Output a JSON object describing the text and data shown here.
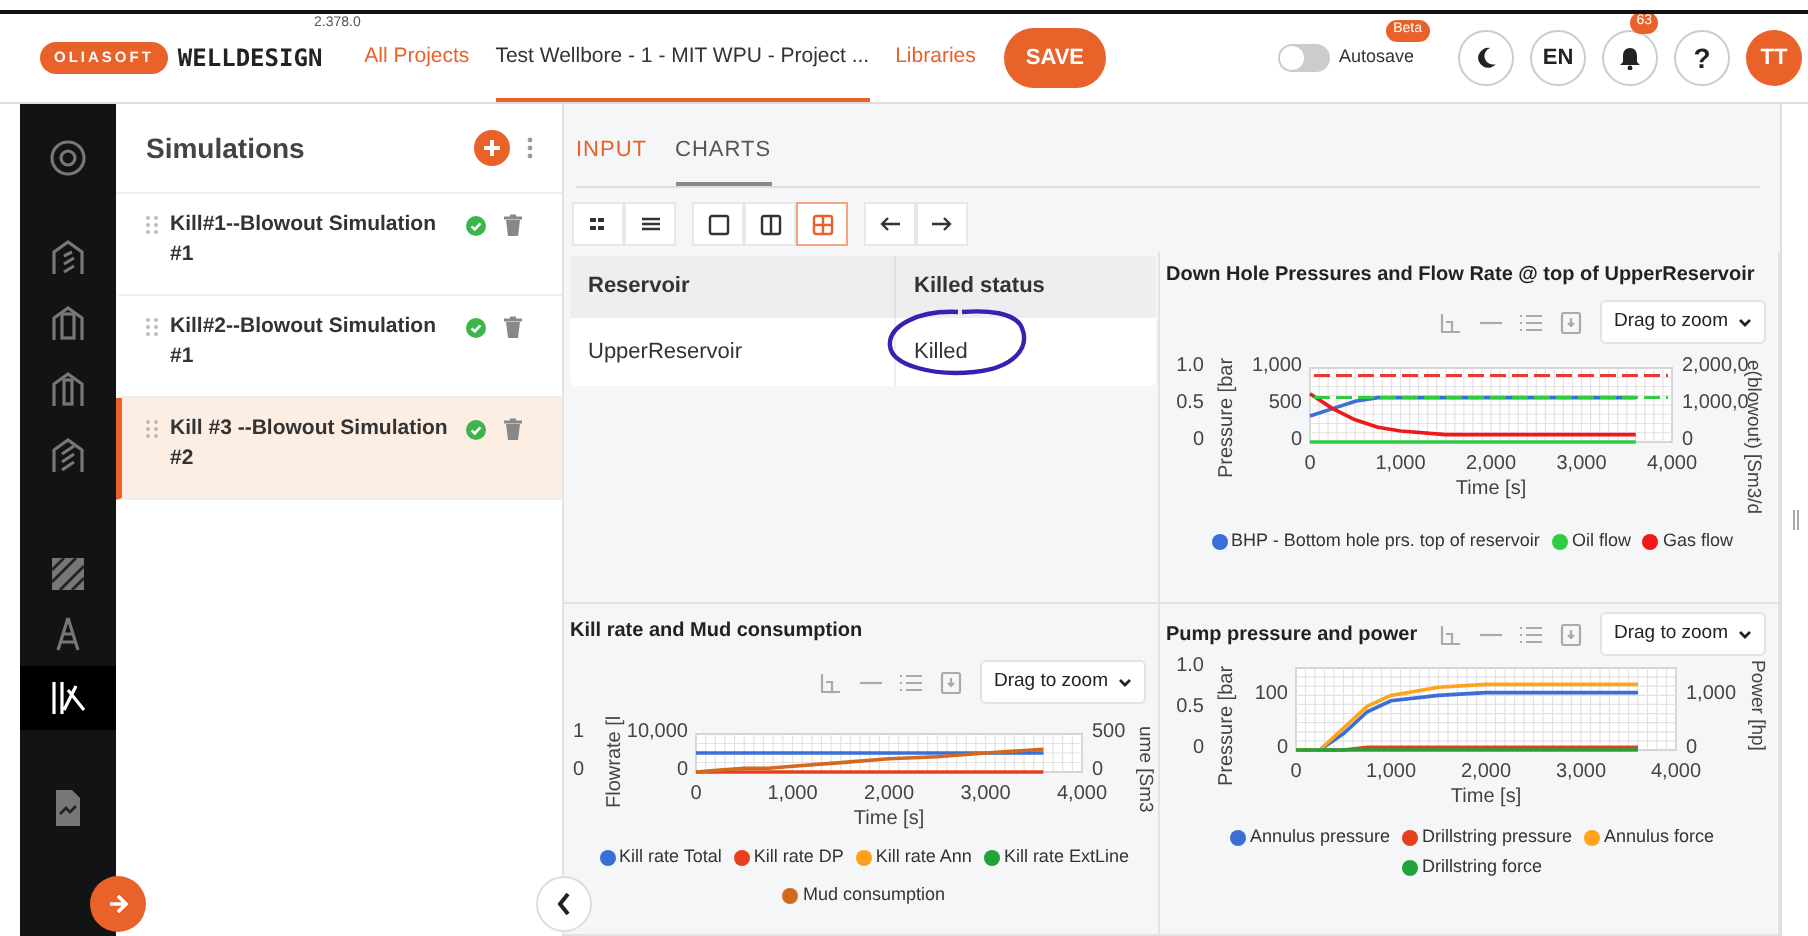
{
  "header": {
    "logo": {
      "brand": "OLIASOFT",
      "product": "WELLDESIGN",
      "version": "2.378.0"
    },
    "nav": [
      {
        "label": "All Projects",
        "selected": false
      },
      {
        "label": "Test Wellbore - 1 - MIT WPU - Project ...",
        "selected": true
      },
      {
        "label": "Libraries",
        "selected": false
      }
    ],
    "save_button": "SAVE",
    "autosave": {
      "label": "Autosave",
      "on": false,
      "badge": "Beta"
    },
    "language": "EN",
    "notifications": "63",
    "help": "?",
    "avatar": "TT"
  },
  "rail": {
    "items": [
      {
        "selected": false
      },
      {
        "selected": false
      },
      {
        "selected": false
      },
      {
        "selected": false
      },
      {
        "selected": false
      },
      {
        "selected": false
      },
      {
        "selected": false
      },
      {
        "selected": true
      },
      {
        "selected": false
      }
    ]
  },
  "simulations": {
    "title": "Simulations",
    "items": [
      {
        "label": "Kill#1--Blowout Simulation #1",
        "selected": false
      },
      {
        "label": "Kill#2--Blowout Simulation #1",
        "selected": false
      },
      {
        "label": "Kill #3 --Blowout Simulation #2",
        "selected": true
      }
    ]
  },
  "tabs": [
    {
      "label": "INPUT",
      "selected": false
    },
    {
      "label": "CHARTS",
      "selected": true
    }
  ],
  "layout_buttons": [
    {
      "selected": false
    },
    {
      "selected": false
    },
    {
      "selected": true
    }
  ],
  "table": {
    "columns": [
      "Reservoir",
      "Killed status"
    ],
    "rows": [
      [
        "UpperReservoir",
        "Killed"
      ]
    ]
  },
  "charts": [
    {
      "title": "Down Hole Pressures and Flow Rate @ top of UpperReservoir",
      "zoom_mode": "Drag to zoom",
      "extra_axes": {
        "left_outer_ticks": [
          "1.0",
          "0.5",
          "0"
        ],
        "right_title": "e(blowout) [Sm3/d",
        "right_ticks": [
          "2,000,0",
          "1,000,0",
          "0"
        ]
      },
      "chart_data": {
        "type": "line",
        "xlabel": "Time [s]",
        "ylabel": "Pressure [bar",
        "grid": true,
        "x": [
          0,
          250,
          500,
          750,
          1000,
          1500,
          2000,
          2500,
          3000,
          3600
        ],
        "xlim": [
          0,
          4000
        ],
        "ylim": [
          0,
          1000
        ],
        "xticks": [
          {
            "value": 0,
            "label": "0"
          },
          {
            "value": 1000,
            "label": "1,000"
          },
          {
            "value": 2000,
            "label": "2,000"
          },
          {
            "value": 3000,
            "label": "3,000"
          },
          {
            "value": 4000,
            "label": "4,000"
          }
        ],
        "yticks": [
          {
            "value": 0,
            "label": "0"
          },
          {
            "value": 500,
            "label": "500"
          },
          {
            "value": 1000,
            "label": "1,000"
          }
        ],
        "series": [
          {
            "name": "BHP - Bottom hole prs. top of reservoir",
            "color": "#3b6fd8",
            "values": [
              350,
              450,
              550,
              600,
              600,
              600,
              600,
              600,
              600,
              600
            ]
          },
          {
            "name": "Oil flow",
            "color": "#2ecc40",
            "values": [
              0,
              0,
              0,
              0,
              0,
              0,
              0,
              0,
              0,
              0
            ]
          },
          {
            "name": "Gas flow",
            "color": "#f01818",
            "values": [
              650,
              450,
              300,
              200,
              150,
              100,
              100,
              100,
              100,
              100
            ]
          }
        ],
        "ref_lines": [
          {
            "axis": "y",
            "value": 900,
            "color": "#e53935"
          },
          {
            "axis": "y",
            "value": 600,
            "color": "#2ecc40"
          }
        ]
      }
    },
    {
      "title": "Kill rate and Mud consumption",
      "zoom_mode": "Drag to zoom",
      "extra_axes": {
        "left_outer_ticks": [
          "1",
          "0"
        ],
        "right_title": "ume [Sm3",
        "right_ticks": [
          "500",
          "0"
        ]
      },
      "chart_data": {
        "type": "line",
        "xlabel": "Time [s]",
        "ylabel": "Flowrate [l",
        "grid": true,
        "x": [
          0,
          250,
          500,
          750,
          1000,
          1500,
          2000,
          2500,
          3000,
          3600
        ],
        "xlim": [
          0,
          4000
        ],
        "ylim": [
          0,
          10000
        ],
        "xticks": [
          {
            "value": 0,
            "label": "0"
          },
          {
            "value": 1000,
            "label": "1,000"
          },
          {
            "value": 2000,
            "label": "2,000"
          },
          {
            "value": 3000,
            "label": "3,000"
          },
          {
            "value": 4000,
            "label": "4,000"
          }
        ],
        "yticks": [
          {
            "value": 0,
            "label": "0"
          },
          {
            "value": 10000,
            "label": "10,000"
          }
        ],
        "series": [
          {
            "name": "Kill rate Total",
            "color": "#3b6fd8",
            "values": [
              5000,
              5000,
              5000,
              5000,
              5000,
              5000,
              5000,
              5000,
              5000,
              5000
            ]
          },
          {
            "name": "Kill rate DP",
            "color": "#e8401c",
            "values": [
              0,
              0,
              0,
              0,
              0,
              0,
              0,
              0,
              0,
              0
            ]
          },
          {
            "name": "Kill rate Ann",
            "color": "#ff9f1a",
            "values": [
              null,
              null,
              null,
              null,
              null,
              null,
              null,
              null,
              null,
              null
            ]
          },
          {
            "name": "Kill rate ExtLine",
            "color": "#22a33a",
            "values": [
              null,
              null,
              null,
              null,
              null,
              null,
              null,
              null,
              null,
              null
            ]
          },
          {
            "name": "Mud consumption",
            "color": "#d2691e",
            "values": [
              0,
              500,
              1000,
              1000,
              1500,
              2500,
              3500,
              4000,
              5000,
              6000
            ]
          }
        ]
      }
    },
    {
      "title": "Pump pressure and power",
      "zoom_mode": "Drag to zoom",
      "extra_axes": {
        "left_outer_ticks": [
          "1.0",
          "0.5",
          "0"
        ],
        "right_title": "Power [hp]",
        "right_ticks": [
          "1,000",
          "0"
        ]
      },
      "chart_data": {
        "type": "line",
        "xlabel": "Time [s]",
        "ylabel": "Pressure [bar",
        "grid": true,
        "x": [
          0,
          250,
          500,
          750,
          1000,
          1500,
          2000,
          2500,
          3000,
          3600
        ],
        "xlim": [
          0,
          4000
        ],
        "ylim": [
          0,
          150
        ],
        "xticks": [
          {
            "value": 0,
            "label": "0"
          },
          {
            "value": 1000,
            "label": "1,000"
          },
          {
            "value": 2000,
            "label": "2,000"
          },
          {
            "value": 3000,
            "label": "3,000"
          },
          {
            "value": 4000,
            "label": "4,000"
          }
        ],
        "yticks": [
          {
            "value": 0,
            "label": "0"
          },
          {
            "value": 100,
            "label": "100"
          }
        ],
        "series": [
          {
            "name": "Annulus pressure",
            "color": "#3b6fd8",
            "values": [
              0,
              0,
              30,
              70,
              90,
              100,
              105,
              105,
              105,
              105
            ]
          },
          {
            "name": "Drillstring pressure",
            "color": "#e8401c",
            "values": [
              0,
              0,
              0,
              5,
              5,
              5,
              5,
              5,
              5,
              5
            ]
          },
          {
            "name": "Annulus force",
            "color": "#ffa31a",
            "values": [
              0,
              0,
              40,
              80,
              100,
              115,
              120,
              120,
              120,
              120
            ]
          },
          {
            "name": "Drillstring force",
            "color": "#22a33a",
            "values": [
              0,
              0,
              0,
              0,
              0,
              0,
              0,
              0,
              0,
              0
            ]
          }
        ]
      }
    }
  ]
}
